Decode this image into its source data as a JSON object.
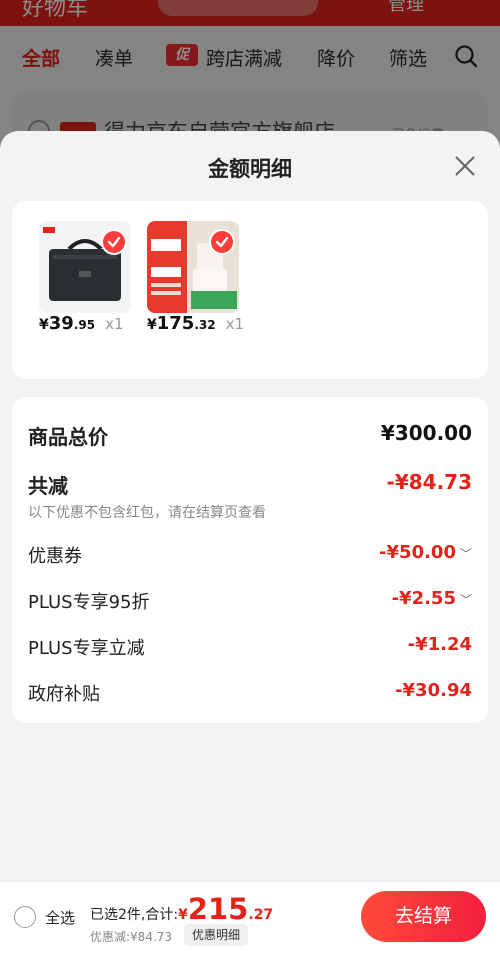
{
  "header_bg": {
    "title_partial": "好物车",
    "right_partial": "管理"
  },
  "filter_tabs": [
    {
      "label": "全部",
      "active": true
    },
    {
      "label": "凑单",
      "active": false
    },
    {
      "label": "跨店满减",
      "active": false,
      "tag": "促"
    },
    {
      "label": "降价",
      "active": false
    },
    {
      "label": "筛选",
      "active": false
    }
  ],
  "store_row_bg": {
    "badge": "自营",
    "name": "得力京东自营官方旗舰店",
    "side": "已免运费"
  },
  "sheet": {
    "title": "金额明细",
    "products": [
      {
        "price_symbol": "¥",
        "price_int": "39",
        "price_dec": ".95",
        "qty": "x1",
        "image": "black-document-bag"
      },
      {
        "price_symbol": "¥",
        "price_int": "175",
        "price_dec": ".32",
        "qty": "x1",
        "image": "paper-towel-pack-promo"
      }
    ],
    "rows": {
      "total": {
        "label": "商品总价",
        "value": "¥300.00"
      },
      "reduced": {
        "label": "共减",
        "value": "-¥84.73",
        "note": "以下优惠不包含红包，请在结算页查看"
      },
      "coupon": {
        "label": "优惠券",
        "value": "-¥50.00"
      },
      "plus95": {
        "label": "PLUS专享95折",
        "value": "-¥2.55"
      },
      "plus_off": {
        "label": "PLUS专享立减",
        "value": "-¥1.24"
      },
      "gov": {
        "label": "政府补贴",
        "value": "-¥30.94"
      }
    }
  },
  "bottom_bar": {
    "select_all": "全选",
    "summary_label": "已选2件,合计:",
    "total_symbol": "¥",
    "total_int": "215",
    "total_dec": ".27",
    "discount_text": "优惠减:¥84.73",
    "detail_link": "优惠明细",
    "checkout": "去结算"
  },
  "colors": {
    "accent": "#e2231a",
    "checkout_gradient_start": "#ff4b3a",
    "checkout_gradient_end": "#f21f3c"
  },
  "icons": [
    "search-icon",
    "close-icon",
    "check-badge-icon",
    "chevron-down-icon"
  ]
}
